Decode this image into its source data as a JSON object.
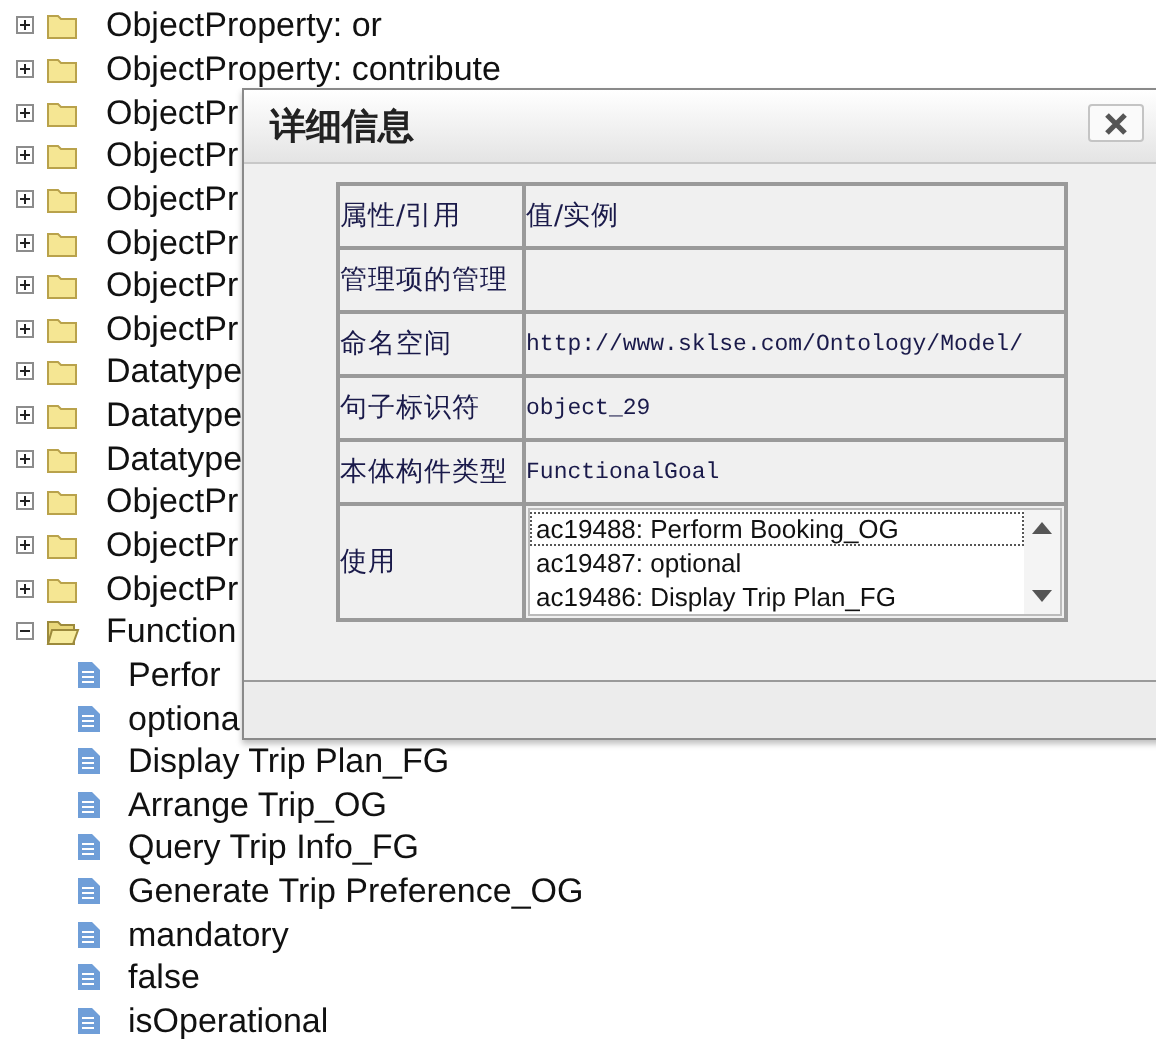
{
  "tree": [
    {
      "label": "ObjectProperty: or",
      "expanded": false
    },
    {
      "label": "ObjectProperty: contribute",
      "expanded": false
    },
    {
      "label": "ObjectPr",
      "expanded": false
    },
    {
      "label": "ObjectPr",
      "expanded": false
    },
    {
      "label": "ObjectPr",
      "expanded": false
    },
    {
      "label": "ObjectPr",
      "expanded": false
    },
    {
      "label": "ObjectPr",
      "expanded": false
    },
    {
      "label": "ObjectPr",
      "expanded": false
    },
    {
      "label": "Datatype",
      "expanded": false
    },
    {
      "label": "Datatype",
      "expanded": false
    },
    {
      "label": "Datatype",
      "expanded": false
    },
    {
      "label": "ObjectPr",
      "expanded": false
    },
    {
      "label": "ObjectPr",
      "expanded": false
    },
    {
      "label": "ObjectPr",
      "expanded": false
    },
    {
      "label": "Function",
      "expanded": true,
      "children": [
        {
          "label": "Perfor"
        },
        {
          "label": "optiona"
        },
        {
          "label": "Display Trip Plan_FG"
        },
        {
          "label": "Arrange Trip_OG"
        },
        {
          "label": "Query Trip Info_FG"
        },
        {
          "label": "Generate Trip Preference_OG"
        },
        {
          "label": "mandatory"
        },
        {
          "label": "false"
        },
        {
          "label": "isOperational"
        }
      ]
    }
  ],
  "dialog": {
    "title": "详细信息",
    "table": {
      "columns": [
        "属性/引用",
        "值/实例"
      ],
      "rows": [
        {
          "kind": "text",
          "property": "管理项的管理"
        },
        {
          "kind": "text",
          "property": "命名空间",
          "value": "http://www.sklse.com/Ontology/Model/"
        },
        {
          "kind": "text",
          "property": "句子标识符",
          "value": "object_29"
        },
        {
          "kind": "text",
          "property": "本体构件类型",
          "value": "FunctionalGoal"
        },
        {
          "kind": "list",
          "property": "使用",
          "items": [
            {
              "text": "ac19488: Perform Booking_OG",
              "focused": true
            },
            {
              "text": "ac19487: optional",
              "focused": false
            },
            {
              "text": "ac19486: Display Trip Plan_FG",
              "focused": false
            }
          ]
        }
      ]
    }
  }
}
